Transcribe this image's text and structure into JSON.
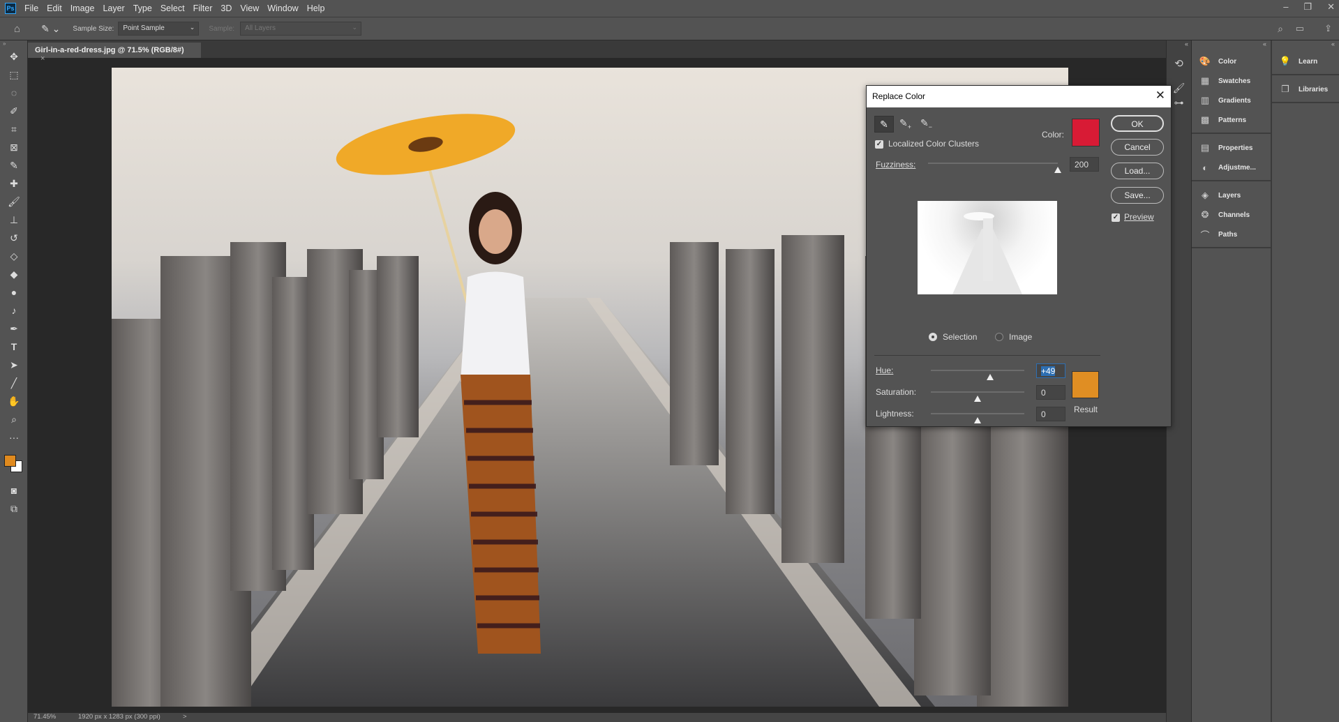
{
  "app": {
    "logo": "Ps"
  },
  "menu": [
    "File",
    "Edit",
    "Image",
    "Layer",
    "Type",
    "Select",
    "Filter",
    "3D",
    "View",
    "Window",
    "Help"
  ],
  "window_controls": {
    "minimize": "–",
    "restore": "❐",
    "close": "✕"
  },
  "options": {
    "sample_size_label": "Sample Size:",
    "sample_size_value": "Point Sample",
    "sample_label": "Sample:",
    "sample_value": "All Layers"
  },
  "document": {
    "tab_title": "Girl-in-a-red-dress.jpg @ 71.5% (RGB/8#)",
    "tab_close": "×"
  },
  "status": {
    "zoom": "71.45%",
    "dimensions": "1920 px x 1283 px (300 ppi)",
    "arrow": ">"
  },
  "colors": {
    "foreground": "#e08a1e",
    "background": "#ffffff",
    "target_color": "#d81b35",
    "result_color": "#e08e23",
    "accent": "#31a8ff"
  },
  "panels": {
    "group1": [
      {
        "label": "Color",
        "icon": "palette-icon"
      },
      {
        "label": "Swatches",
        "icon": "grid-icon"
      },
      {
        "label": "Gradients",
        "icon": "gradient-icon"
      },
      {
        "label": "Patterns",
        "icon": "pattern-icon"
      }
    ],
    "group2": [
      {
        "label": "Properties",
        "icon": "properties-icon"
      },
      {
        "label": "Adjustme...",
        "icon": "adjustments-icon"
      }
    ],
    "group3": [
      {
        "label": "Layers",
        "icon": "layers-icon"
      },
      {
        "label": "Channels",
        "icon": "channels-icon"
      },
      {
        "label": "Paths",
        "icon": "paths-icon"
      }
    ],
    "col3": [
      {
        "label": "Learn",
        "icon": "lightbulb-icon"
      },
      {
        "label": "Libraries",
        "icon": "libraries-icon"
      }
    ]
  },
  "dialog": {
    "title": "Replace Color",
    "localized_label": "Localized Color Clusters",
    "localized_checked": true,
    "color_label": "Color:",
    "fuzziness_label": "Fuzziness:",
    "fuzziness_value": "200",
    "fuzziness_range": [
      0,
      200
    ],
    "radio_selection": "Selection",
    "radio_image": "Image",
    "selected_view": "Selection",
    "hue_label": "Hue:",
    "hue_value": "+49",
    "hue_range": [
      -180,
      180
    ],
    "saturation_label": "Saturation:",
    "saturation_value": "0",
    "lightness_label": "Lightness:",
    "lightness_value": "0",
    "result_label": "Result",
    "buttons": {
      "ok": "OK",
      "cancel": "Cancel",
      "load": "Load...",
      "save": "Save..."
    },
    "preview_label": "Preview",
    "preview_checked": true
  }
}
